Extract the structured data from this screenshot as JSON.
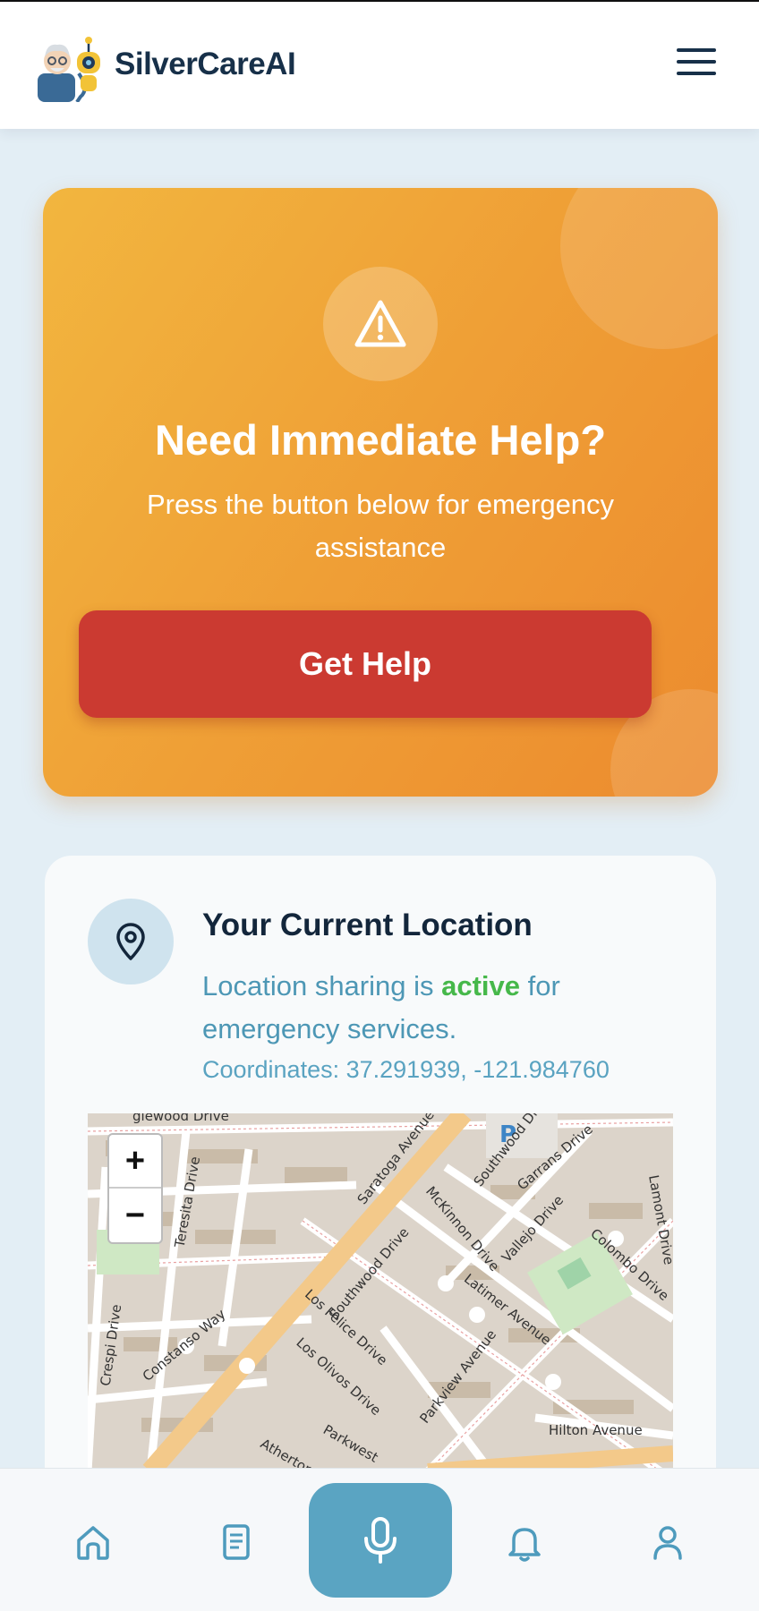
{
  "app": {
    "name": "SilverCareAI"
  },
  "emergency": {
    "title": "Need Immediate Help?",
    "subtitle": "Press the button below for emergency assistance",
    "button_label": "Get Help"
  },
  "location": {
    "title": "Your Current Location",
    "sharing_prefix": "Location sharing is ",
    "sharing_status": "active",
    "sharing_suffix": " for emergency services.",
    "coordinates": "Coordinates: 37.291939, -121.984760",
    "map": {
      "zoom_in": "+",
      "zoom_out": "−",
      "labels": {
        "l1": "glewood Drive",
        "l2": "Saratoga Avenue",
        "l3": "Southwood Drive",
        "l4": "Garrans Drive",
        "l5": "Lamont Drive",
        "l6": "Teresita Drive",
        "l7": "McKinnon Drive",
        "l8": "Vallejo Drive",
        "l9": "Colombo Drive",
        "l10": "Southwood Drive",
        "l11": "Latimer Avenue",
        "l12": "Los Felice Drive",
        "l13": "Constanso Way",
        "l14": "Crespi Drive",
        "l15": "Los Olivos Drive",
        "l16": "Parkview Avenue",
        "l17": "Hilton Avenue",
        "l18": "Parkwest",
        "l19": "Atherton",
        "l20": "P"
      }
    }
  },
  "nav": {
    "items": [
      "home-icon",
      "journal-icon",
      "microphone-icon",
      "bell-icon",
      "user-icon"
    ],
    "accent": "#5aa4c2"
  },
  "colors": {
    "help_button": "#cb3a31",
    "active_status": "#46b84a",
    "brand_text": "#173049"
  }
}
